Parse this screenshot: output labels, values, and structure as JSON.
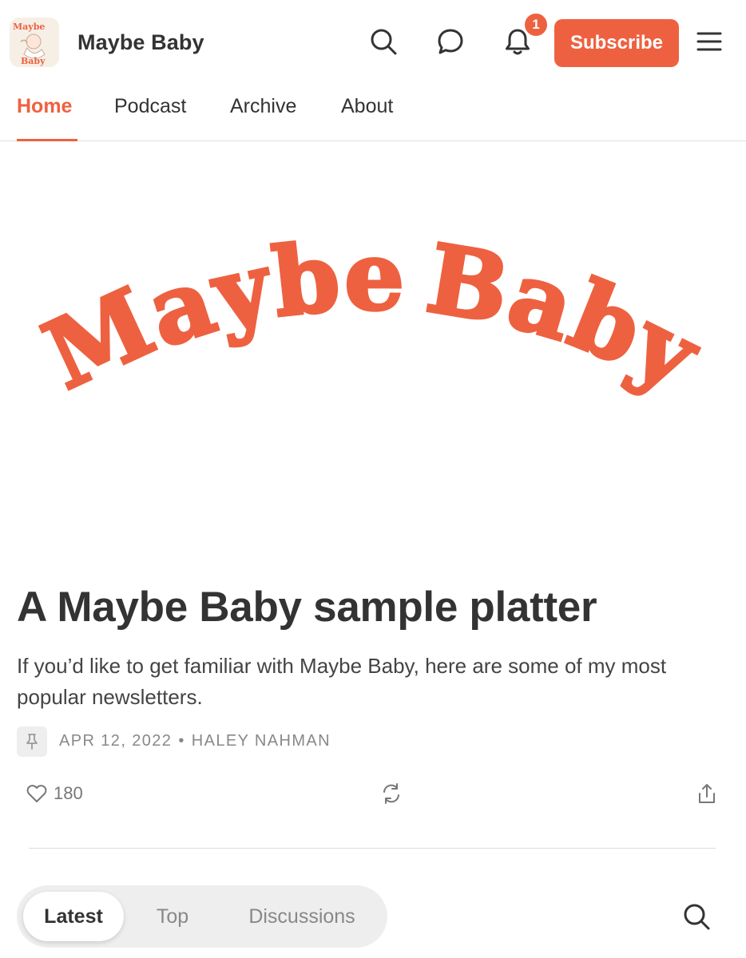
{
  "brand": {
    "name": "Maybe Baby",
    "logo_text_top": "Maybe",
    "logo_text_bottom": "Baby",
    "accent_color": "#ee6140"
  },
  "header": {
    "notification_count": "1",
    "subscribe_label": "Subscribe",
    "icons": [
      "search-icon",
      "chat-bubble-icon",
      "bell-icon",
      "menu-icon"
    ]
  },
  "nav": {
    "tabs": [
      {
        "label": "Home",
        "active": true
      },
      {
        "label": "Podcast",
        "active": false
      },
      {
        "label": "Archive",
        "active": false
      },
      {
        "label": "About",
        "active": false
      }
    ]
  },
  "hero": {
    "wordmark_line_1": "Maybe",
    "wordmark_line_2": "Baby"
  },
  "post": {
    "title": "A Maybe Baby sample platter",
    "subtitle": "If you’d like to get familiar with Maybe Baby, here are some of my most popular newsletters.",
    "date": "APR 12, 2022",
    "separator": "•",
    "author": "HALEY NAHMAN",
    "like_count": "180",
    "icons": [
      "pin-icon",
      "heart-icon",
      "repost-icon",
      "share-icon"
    ]
  },
  "feed_filter": {
    "tabs": [
      {
        "label": "Latest",
        "active": true
      },
      {
        "label": "Top",
        "active": false
      },
      {
        "label": "Discussions",
        "active": false
      }
    ],
    "search_icon": "search-icon"
  }
}
